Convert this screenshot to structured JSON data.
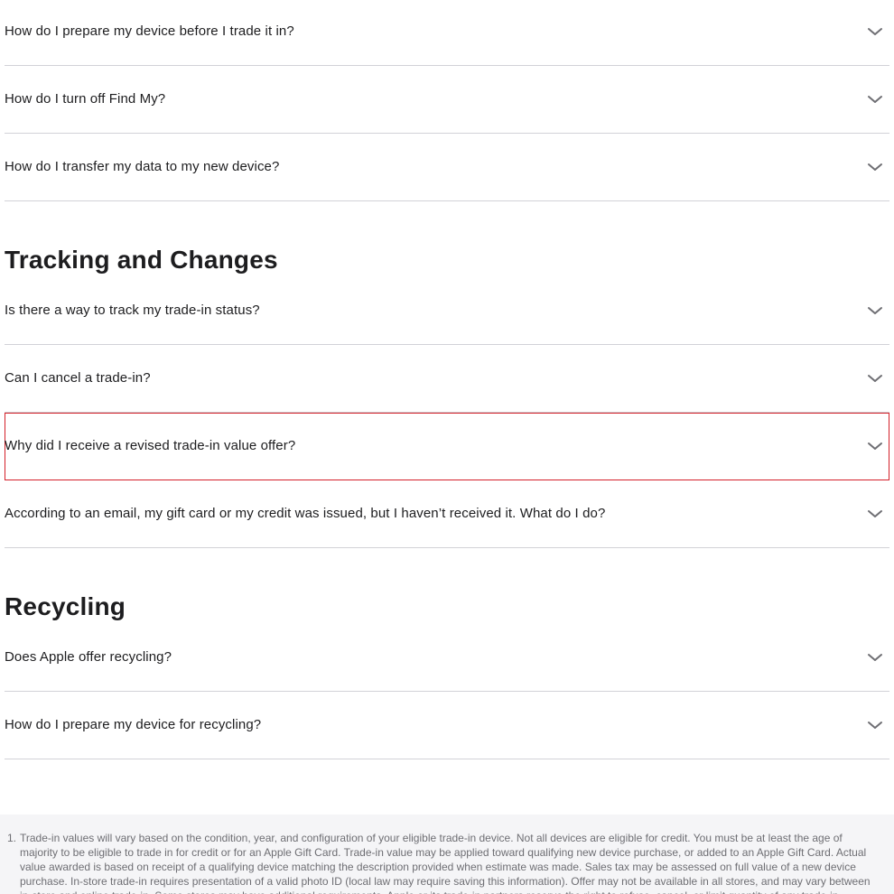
{
  "sections": [
    {
      "title": "",
      "items": [
        "How do I prepare my device before I trade it in?",
        "How do I turn off Find My?",
        "How do I transfer my data to my new device?"
      ]
    },
    {
      "title": "Tracking and Changes",
      "items": [
        "Is there a way to track my trade-in status?",
        "Can I cancel a trade-in?",
        "Why did I receive a revised trade-in value offer?",
        "According to an email, my gift card or my credit was issued, but I haven’t received it. What do I do?"
      ]
    },
    {
      "title": "Recycling",
      "items": [
        "Does Apple offer recycling?",
        "How do I prepare my device for recycling?"
      ]
    }
  ],
  "highlight_color": "#d4202a",
  "chevron_icon": "chevron-down-icon",
  "footnote": {
    "number": "1.",
    "text": "Trade-in values will vary based on the condition, year, and configuration of your eligible trade-in device. Not all devices are eligible for credit. You must be at least the age of majority to be eligible to trade in for credit or for an Apple Gift Card. Trade-in value may be applied toward qualifying new device purchase, or added to an Apple Gift Card. Actual value awarded is based on receipt of a qualifying device matching the description provided when estimate was made. Sales tax may be assessed on full value of a new device purchase. In-store trade-in requires presentation of a valid photo ID (local law may require saving this information). Offer may not be available in all stores, and may vary between in-store and online trade-in. Some stores may have additional requirements. Apple or its trade-in partners reserve the right to refuse, cancel, or limit quantity of any trade-in transaction for any reason."
  }
}
